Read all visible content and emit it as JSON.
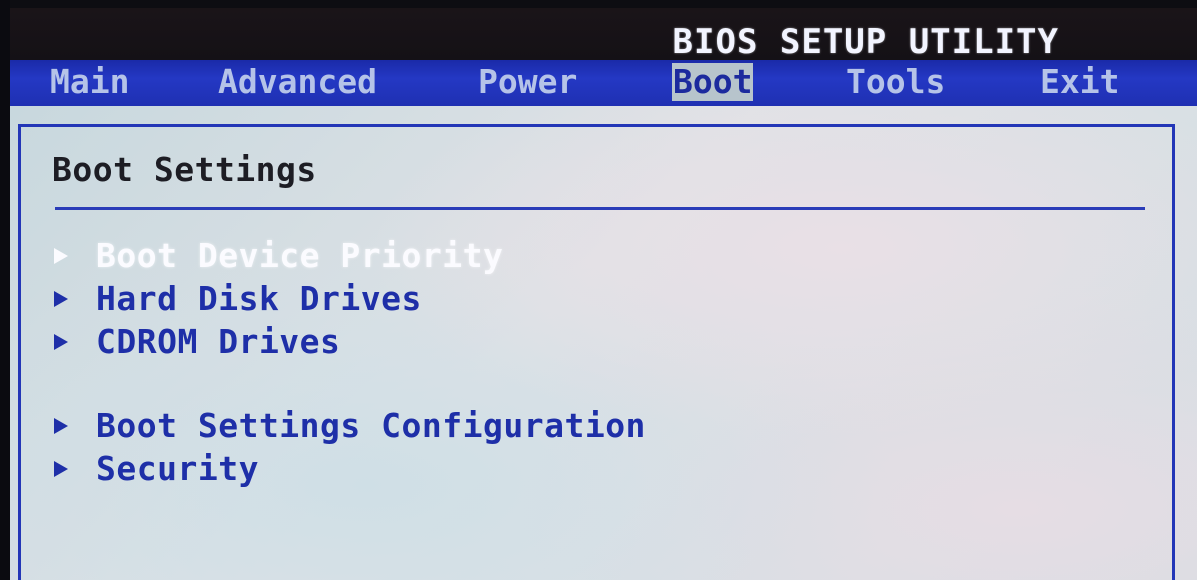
{
  "header": {
    "title": "BIOS SETUP UTILITY"
  },
  "menu": {
    "items": [
      {
        "label": "Main"
      },
      {
        "label": "Advanced"
      },
      {
        "label": "Power"
      },
      {
        "label": "Boot",
        "active": true
      },
      {
        "label": "Tools"
      },
      {
        "label": "Exit"
      }
    ]
  },
  "panel": {
    "title": "Boot Settings",
    "entries": [
      {
        "label": "Boot Device Priority",
        "selected": true
      },
      {
        "label": "Hard Disk Drives"
      },
      {
        "label": "CDROM Drives"
      },
      {
        "label": "Boot Settings Configuration"
      },
      {
        "label": "Security"
      }
    ]
  },
  "colors": {
    "menubar": "#2438c4",
    "accent_text": "#1e2fa8",
    "selected_text": "#fbfbff",
    "panel_background": "#d6e0e4"
  },
  "icons": {
    "submenu": "submenu-arrow-icon"
  }
}
